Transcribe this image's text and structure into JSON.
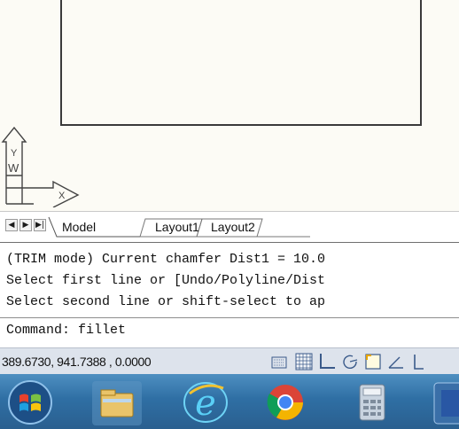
{
  "tabs": {
    "nav_buttons": [
      "◀",
      "▶",
      "▶|"
    ],
    "model": "Model",
    "layout1": "Layout1",
    "layout2": "Layout2"
  },
  "ucs": {
    "y_label": "Y",
    "w_label": "W",
    "x_label": "X"
  },
  "command_window": {
    "history": [
      "(TRIM mode) Current chamfer Dist1 = 10.0",
      "Select first line or [Undo/Polyline/Dist",
      "Select second line or shift-select to ap"
    ],
    "input": "Command: fillet"
  },
  "status_bar": {
    "coordinates": "389.6730, 941.7388 , 0.0000",
    "toggle_icons": [
      "snap-icon",
      "grid-icon",
      "ortho-icon",
      "polar-icon",
      "osnap-icon",
      "otrack-icon",
      "ducs-icon"
    ]
  },
  "taskbar": {
    "icons": [
      "windows-start-icon",
      "file-explorer-icon",
      "internet-explorer-icon",
      "chrome-icon",
      "calculator-icon",
      "app-icon"
    ]
  },
  "colors": {
    "canvas": "#fcfbf5",
    "taskbar": "#2f6fa4",
    "status_bar": "#dde3ec"
  }
}
